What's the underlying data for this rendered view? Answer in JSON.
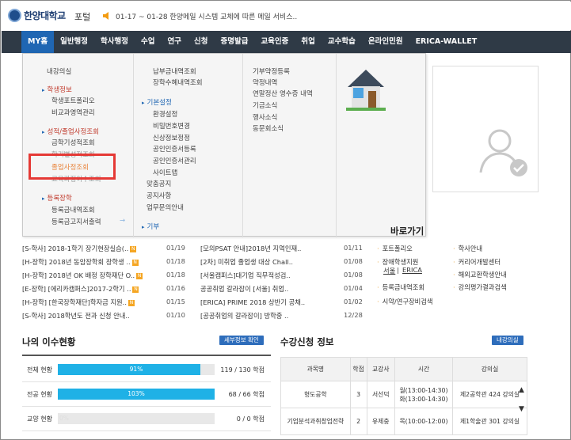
{
  "header": {
    "logo_text": "한양대학교",
    "portal_label": "포털",
    "notice": "01-17 ~ 01-28 한양메일 시스템 교체에 따른 메일 서비스.."
  },
  "nav": {
    "items": [
      "MY홈",
      "일반행정",
      "학사행정",
      "수업",
      "연구",
      "신청",
      "증명발급",
      "교육인증",
      "취업",
      "교수학습",
      "온라인민원",
      "ERICA-WALLET"
    ]
  },
  "mega": {
    "col1": {
      "item_top": "내강의실",
      "section1": "학생정보",
      "s1_items": [
        "학생포트폴리오",
        "비교과영역관리"
      ],
      "section2": "성적/졸업사정조회",
      "s2_items": [
        "금학기성적조회",
        "학기별성적조회",
        "졸업사정조회",
        "교육과정이수조회"
      ],
      "section3": "등록장학",
      "s3_items": [
        "등록금내역조회",
        "등록금고지서출력"
      ]
    },
    "col2": {
      "top_items": [
        "납부금내역조회",
        "장학수혜내역조회"
      ],
      "section": "기본설정",
      "sec_items": [
        "환경설정",
        "비밀번호변경",
        "신상정보정정",
        "공인인증서등록",
        "공인인증서관리",
        "사이트맵"
      ],
      "bottom_items": [
        "맞춤공지",
        "공지사항",
        "업무문의안내"
      ],
      "section_b": "기부"
    },
    "col3": {
      "items": [
        "기부약정등록",
        "약정내역",
        "연말정산 영수증 내역",
        "기금소식",
        "행사소식",
        "동문회소식"
      ]
    }
  },
  "notices_left": [
    {
      "text": "[S-학사] 2018-1학기 장기현장실습(..",
      "date": "01/19",
      "new": true
    },
    {
      "text": "[H-장학] 2018년 동암장학회 장학생 ..",
      "date": "01/18",
      "new": true
    },
    {
      "text": "[H-장학] 2018년 OK 배정 장학재단 O..",
      "date": "01/18",
      "new": true
    },
    {
      "text": "[E-장학] [에리카캠퍼스]2017-2학기 ..",
      "date": "01/16",
      "new": true
    },
    {
      "text": "[H-장학] [한국장학재단]학자금 지원..",
      "date": "01/15",
      "new": true
    },
    {
      "text": "[S-학사] 2018학년도 전과 신청 안내..",
      "date": "01/10",
      "new": false
    }
  ],
  "notices_mid": [
    {
      "text": "[모의PSAT 안내]2018년 지역인재..",
      "date": "01/11"
    },
    {
      "text": "[2차] 미취업 졸업생 대상 Chall..",
      "date": "01/08"
    },
    {
      "text": "[서울캠퍼스]대기업 직무적성검..",
      "date": "01/08"
    },
    {
      "text": "공공취업 갈라잡이 [서울] 취업..",
      "date": "01/04"
    },
    {
      "text": "[ERICA] PRIME 2018 상반기 공채..",
      "date": "01/02"
    },
    {
      "text": "[공공취업의 갈라잡이] 방학중 ..",
      "date": "12/28"
    }
  ],
  "shortcuts_title": "바로가기",
  "shortcuts_left": [
    "포트폴리오",
    "장애학생지원",
    "등록금내역조회",
    "시약/연구장비검색"
  ],
  "shortcut_sub": {
    "left": "서울",
    "sep": "|",
    "right": "ERICA"
  },
  "shortcuts_right": [
    "학사안내",
    "커리어개발센터",
    "해외교환학생안내",
    "강의평가결과검색"
  ],
  "progress": {
    "title": "나의 이수현황",
    "button": "세부정보 확인",
    "rows": [
      {
        "label": "전체 현황",
        "percent": 91,
        "percent_text": "91%",
        "value": "119 / 130 학점"
      },
      {
        "label": "전공 현황",
        "percent": 100,
        "percent_text": "103%",
        "value": "68 / 66 학점"
      },
      {
        "label": "교양 현황",
        "percent": 0,
        "percent_text": "0%",
        "value": "0 / 0 학점"
      }
    ]
  },
  "courses": {
    "title": "수강신청 정보",
    "button": "내강의실",
    "headers": [
      "과목명",
      "학점",
      "교강사",
      "시간",
      "강의실"
    ],
    "rows": [
      {
        "name": "형도공학",
        "credit": "3",
        "prof": "서선덕",
        "time1": "월(13:00-14:30)",
        "time2": "화(13:00-14:30)",
        "room": "제2공학관 424 강의실"
      },
      {
        "name": "기업분석과취창업전략",
        "credit": "2",
        "prof": "유제충",
        "time1": "목(10:00-12:00)",
        "time2": "",
        "room": "제1학술관 301 강의실"
      }
    ]
  },
  "colors": {
    "nav": "#2f3a46",
    "active": "#1f66b3",
    "progress": "#1fb1e6",
    "highlight": "#e53935"
  }
}
